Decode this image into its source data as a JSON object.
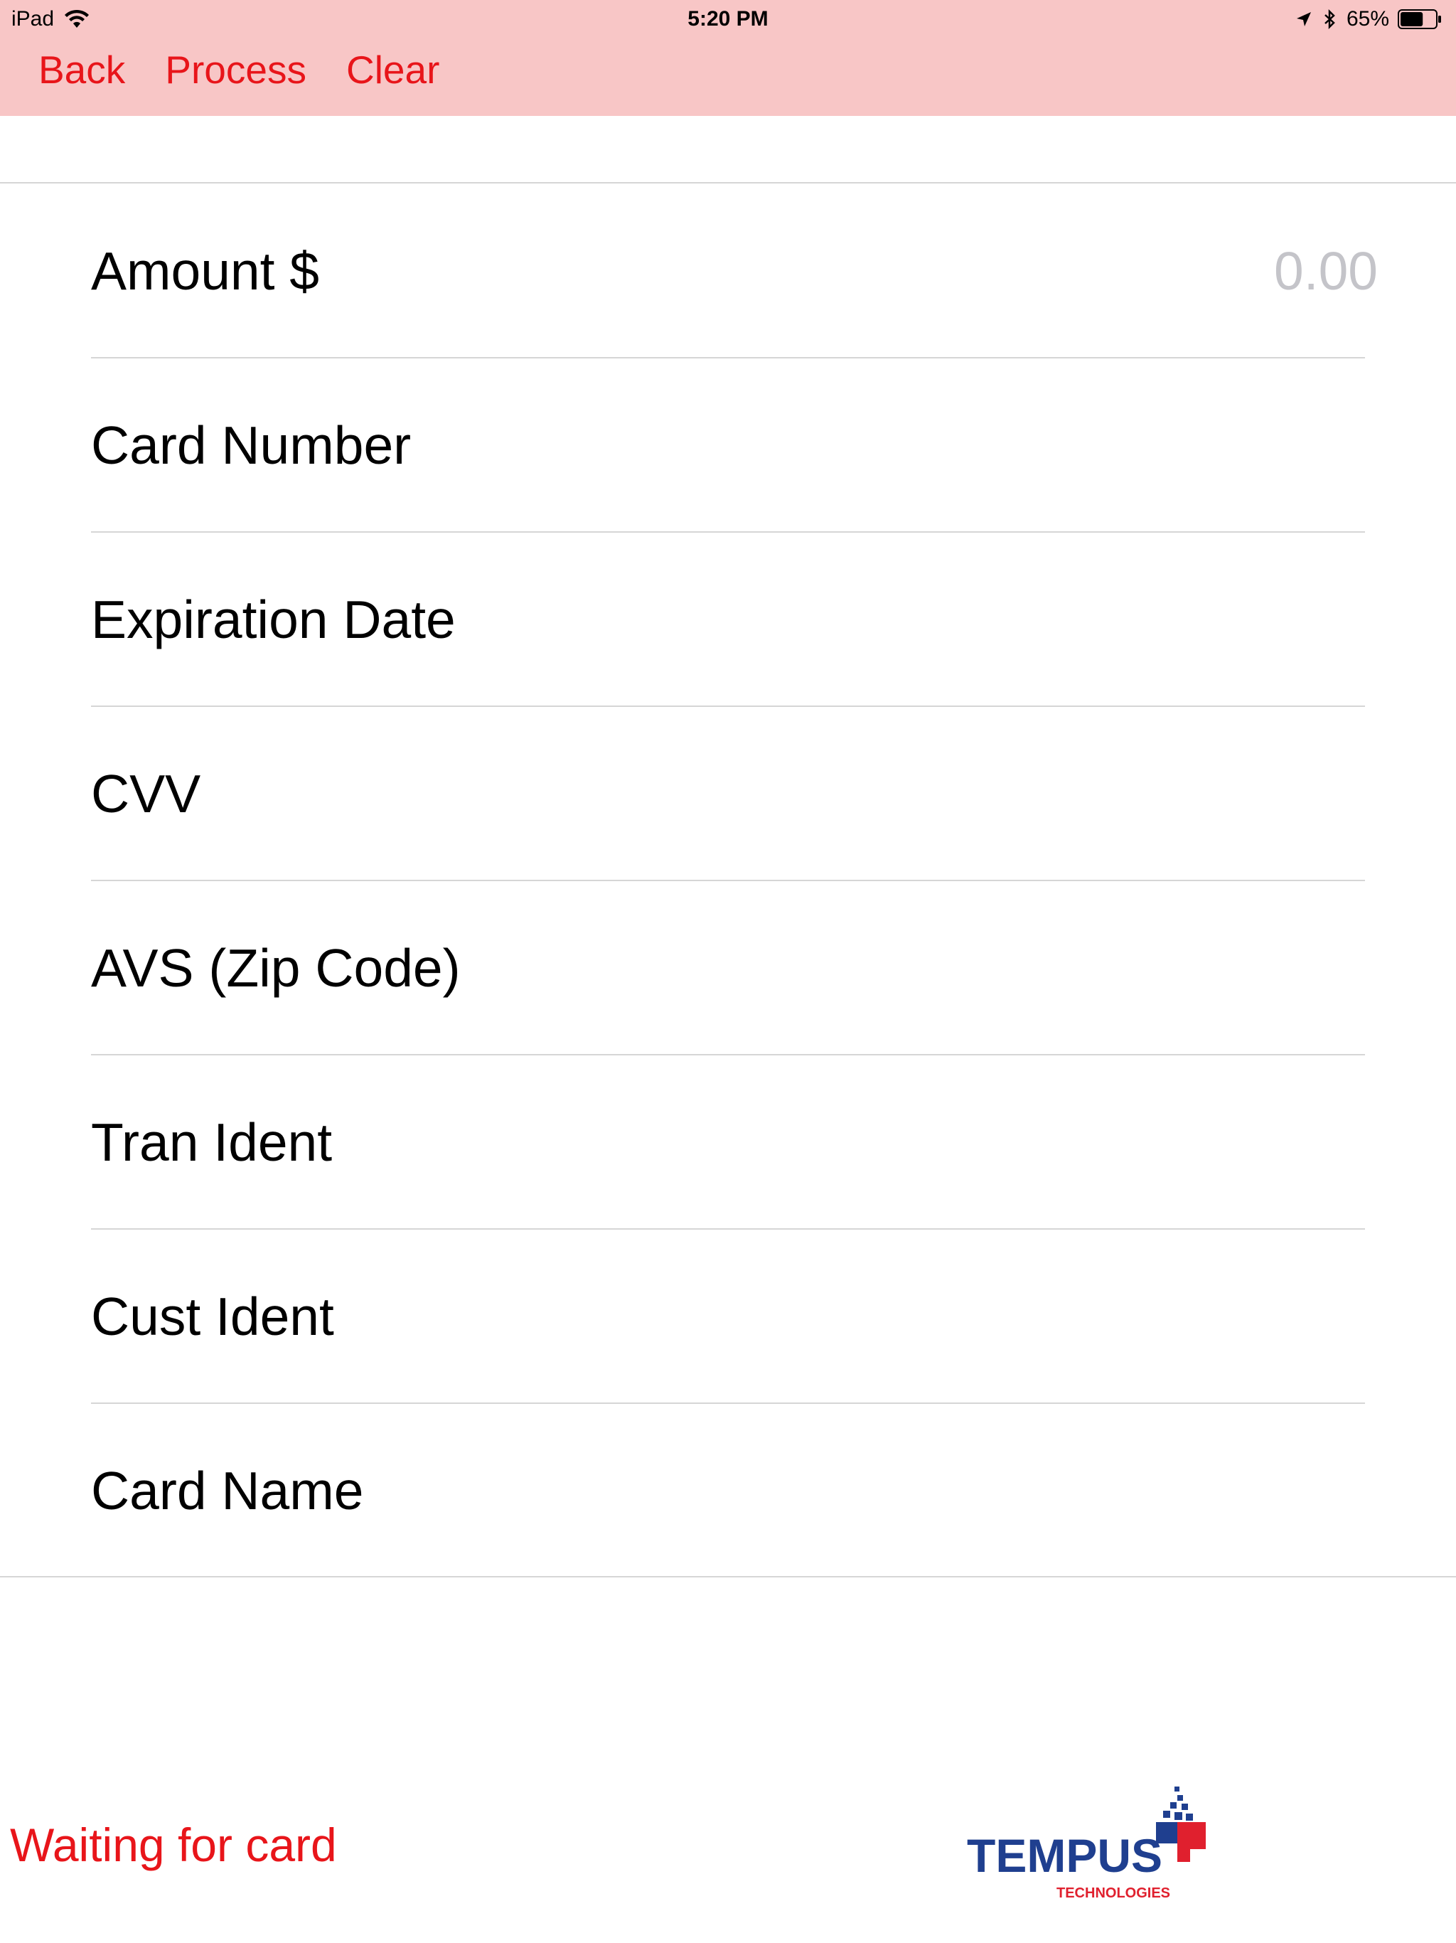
{
  "status_bar": {
    "device": "iPad",
    "time": "5:20 PM",
    "battery": "65%",
    "battery_level": 0.65
  },
  "nav": {
    "back": "Back",
    "process": "Process",
    "clear": "Clear"
  },
  "form": {
    "amount_label": "Amount $",
    "amount_placeholder": "0.00",
    "card_number_label": "Card Number",
    "expiration_label": "Expiration Date",
    "cvv_label": "CVV",
    "avs_label": "AVS (Zip Code)",
    "tran_ident_label": "Tran Ident",
    "cust_ident_label": "Cust Ident",
    "card_name_label": "Card Name"
  },
  "status_message": "Waiting for card",
  "logo": {
    "name": "TEMPUS",
    "subtitle": "TECHNOLOGIES"
  },
  "colors": {
    "accent": "#e8151a",
    "header_bg": "#f8c6c6",
    "logo_blue": "#1f3f8f",
    "logo_red": "#e0202e"
  }
}
